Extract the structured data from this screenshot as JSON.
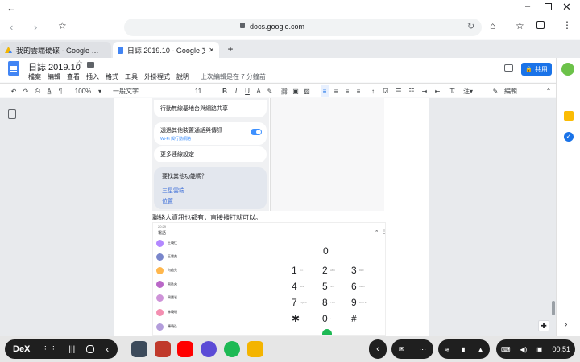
{
  "browser": {
    "url": "docs.google.com",
    "tabs": [
      {
        "label": "我的雲端硬碟 - Google 雲端硬碟"
      },
      {
        "label": "日誌 2019.10 - Google 文件"
      }
    ]
  },
  "doc": {
    "title": "日誌 2019.10",
    "menus": [
      "檔案",
      "編輯",
      "查看",
      "插入",
      "格式",
      "工具",
      "外掛程式",
      "說明"
    ],
    "last_edit": "上次編輯是在 7 分鐘前",
    "share_label": "共用",
    "toolbar": {
      "zoom": "100%",
      "style": "一般文字",
      "font_size": "11",
      "mode": "編輯"
    },
    "body_text": "聯絡人資訊也都有，直接撥打就可以。"
  },
  "settings_shot": {
    "items": [
      {
        "label": "行動無線基地台與網路共享"
      },
      {
        "label": "透過其他裝置通話與傳訊",
        "sublabel": "Wi-Fi 與行動網路"
      },
      {
        "label": "更多連線設定"
      }
    ],
    "suggest": {
      "title": "要找其他功能嗎？",
      "links": [
        "三星雲端",
        "位置"
      ]
    }
  },
  "dialer_shot": {
    "header_time": "20:29",
    "tab_label": "電話",
    "contacts": [
      {
        "name": "王曉仁",
        "color": "#b388ff"
      },
      {
        "name": "王雪美",
        "color": "#7986cb"
      },
      {
        "name": "何啟先",
        "color": "#ffb74d"
      },
      {
        "name": "吳廷英",
        "color": "#ba68c8"
      },
      {
        "name": "周國岩",
        "color": "#ce93d8"
      },
      {
        "name": "林曉明",
        "color": "#f48fb1"
      },
      {
        "name": "陳曉弘",
        "color": "#b39ddb"
      }
    ],
    "display": "0",
    "keys": [
      {
        "digit": "1",
        "sub": "∞∞"
      },
      {
        "digit": "2",
        "sub": "ABC"
      },
      {
        "digit": "3",
        "sub": "DEF"
      },
      {
        "digit": "4",
        "sub": "GHI"
      },
      {
        "digit": "5",
        "sub": "JKL"
      },
      {
        "digit": "6",
        "sub": "MNO"
      },
      {
        "digit": "7",
        "sub": "PQRS"
      },
      {
        "digit": "8",
        "sub": "TUV"
      },
      {
        "digit": "9",
        "sub": "WXYZ"
      },
      {
        "digit": "✱",
        "sub": ""
      },
      {
        "digit": "0",
        "sub": "+"
      },
      {
        "digit": "#",
        "sub": ""
      }
    ]
  },
  "taskbar": {
    "dex_label": "DeX",
    "clock": "00:51"
  },
  "colors": {
    "accent": "#1a73e8",
    "toggle": "#3e91ff",
    "taskbar_pill": "#1f1f1f"
  }
}
